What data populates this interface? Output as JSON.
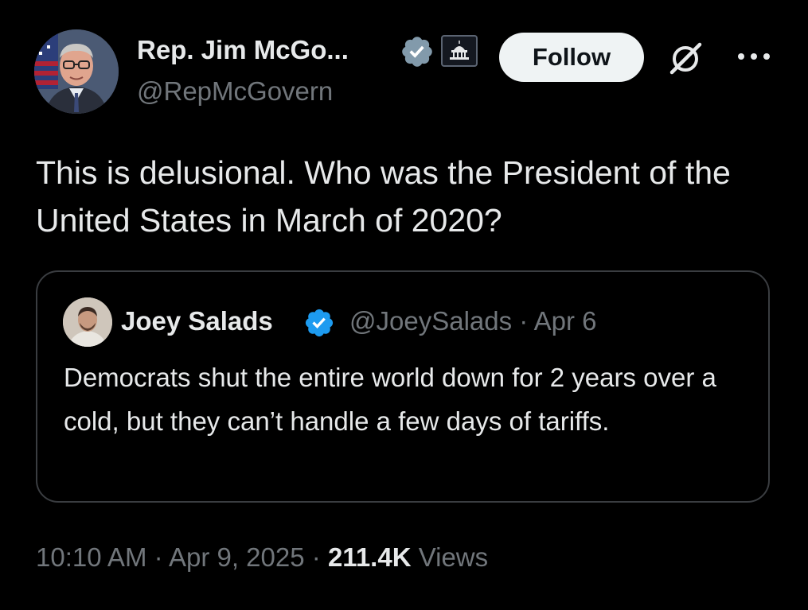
{
  "tweet": {
    "author": {
      "name": "Rep. Jim McGo...",
      "handle": "@RepMcGovern",
      "verified_badge_color": "#829aab"
    },
    "follow_label": "Follow",
    "text": "This is delusional. Who was the President of the United States in March of 2020?",
    "quote": {
      "name": "Joey Salads",
      "handle": "@JoeySalads",
      "separator": "·",
      "date": "Apr 6",
      "text": "Democrats shut the entire world down for 2 years over a cold, but they can’t handle a few days of tariffs.",
      "verified_badge_color": "#1d9bf0"
    },
    "footer": {
      "time": "10:10 AM",
      "separator": "·",
      "date": "Apr 9, 2025",
      "views_count": "211.4K",
      "views_label": "Views"
    }
  },
  "colors": {
    "background": "#000000",
    "text_primary": "#e7e9ea",
    "text_secondary": "#71767b",
    "follow_bg": "#eff3f4",
    "card_border": "#3a3d41"
  },
  "icons": {
    "gray_verified": "verified-badge-gray-icon",
    "government": "government-capitol-icon",
    "grok": "grok-icon",
    "more": "more-options-icon",
    "blue_verified": "verified-badge-blue-icon"
  }
}
